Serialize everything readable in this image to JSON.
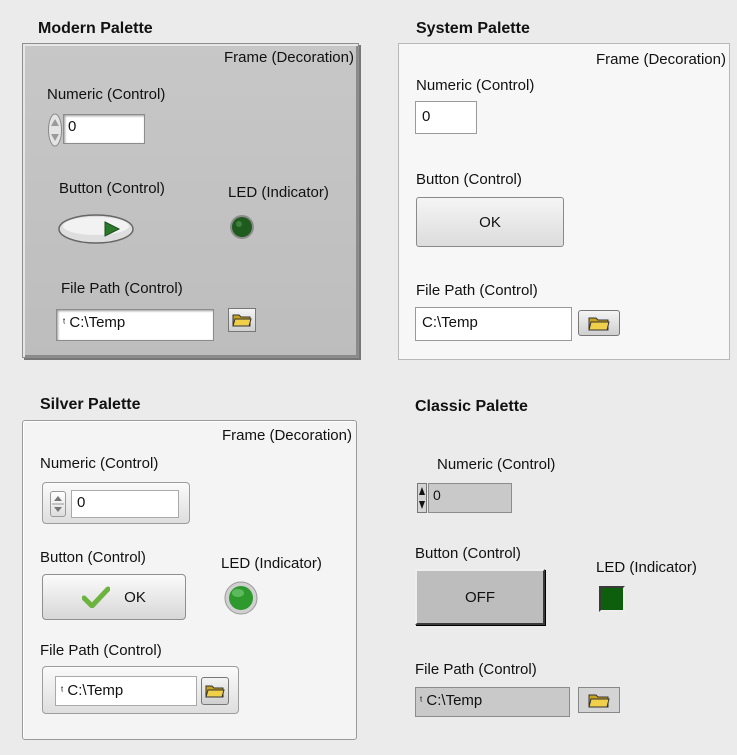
{
  "modern": {
    "title": "Modern Palette",
    "frame_caption": "Frame (Decoration)",
    "numeric_label": "Numeric (Control)",
    "numeric_value": "0",
    "button_label": "Button (Control)",
    "led_label": "LED (Indicator)",
    "path_label": "File Path (Control)",
    "path_value": "C:\\Temp"
  },
  "system": {
    "title": "System Palette",
    "frame_caption": "Frame (Decoration)",
    "numeric_label": "Numeric (Control)",
    "numeric_value": "0",
    "button_label": "Button (Control)",
    "button_text": "OK",
    "path_label": "File Path (Control)",
    "path_value": "C:\\Temp"
  },
  "silver": {
    "title": "Silver Palette",
    "frame_caption": "Frame (Decoration)",
    "numeric_label": "Numeric (Control)",
    "numeric_value": "0",
    "button_label": "Button (Control)",
    "button_text": "OK",
    "led_label": "LED (Indicator)",
    "path_label": "File Path (Control)",
    "path_value": "C:\\Temp"
  },
  "classic": {
    "title": "Classic Palette",
    "numeric_label": "Numeric (Control)",
    "numeric_value": "0",
    "button_label": "Button (Control)",
    "button_text": "OFF",
    "led_label": "LED (Indicator)",
    "path_label": "File Path (Control)",
    "path_value": "C:\\Temp"
  },
  "colors": {
    "background": "#ebebeb",
    "modern_frame": "#c2c2c2",
    "led_dark_green": "#1f5a1f",
    "led_bright_green": "#2e9a2e",
    "classic_led": "#0d5e0d",
    "folder_icon": "#e8c23a"
  }
}
